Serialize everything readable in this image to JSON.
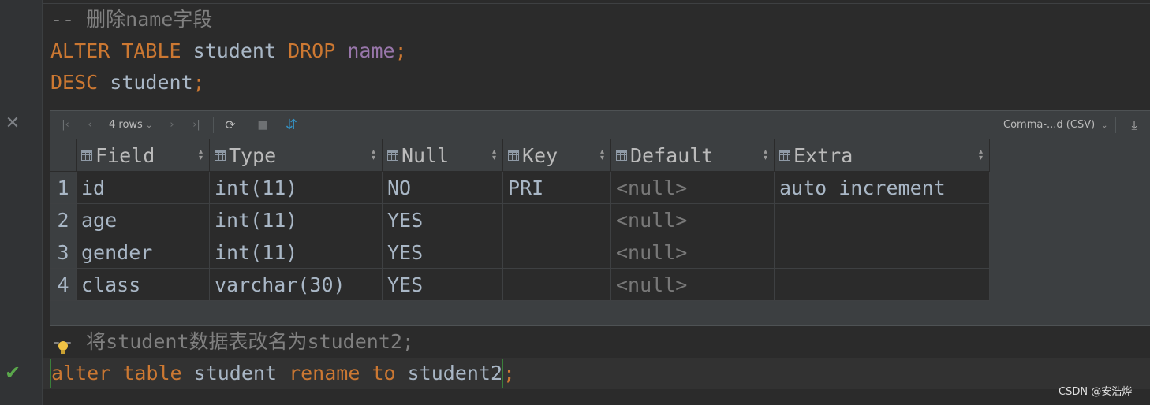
{
  "editor": {
    "line1": {
      "comment": "-- 删除name字段"
    },
    "line2": {
      "kw1": "ALTER",
      "kw2": "TABLE",
      "ident": "student",
      "kw3": "DROP",
      "col": "name",
      "semi": ";"
    },
    "line3": {
      "kw": "DESC",
      "ident": "student",
      "semi": ";"
    },
    "line5": {
      "comment": "-- 将student数据表改名为student2;"
    },
    "line6": {
      "kw1": "alter",
      "kw2": "table",
      "ident": "student",
      "kw3": "rename",
      "kw4": "to",
      "ident2": "student2",
      "semi": ";"
    }
  },
  "gutter": {
    "close_icon": "close-icon",
    "check_icon": "checkmark-icon"
  },
  "results": {
    "toolbar": {
      "rows_label": "4 rows",
      "export_format": "Comma-...d (CSV)",
      "icons": [
        "first-page-icon",
        "previous-page-icon",
        "next-page-icon",
        "last-page-icon",
        "refresh-icon",
        "stop-icon",
        "sort-icon",
        "download-icon"
      ]
    },
    "columns": [
      "Field",
      "Type",
      "Null",
      "Key",
      "Default",
      "Extra"
    ],
    "rows": [
      {
        "num": "1",
        "Field": "id",
        "Type": "int(11)",
        "Null": "NO",
        "Key": "PRI",
        "Default": "<null>",
        "Extra": "auto_increment"
      },
      {
        "num": "2",
        "Field": "age",
        "Type": "int(11)",
        "Null": "YES",
        "Key": "",
        "Default": "<null>",
        "Extra": ""
      },
      {
        "num": "3",
        "Field": "gender",
        "Type": "int(11)",
        "Null": "YES",
        "Key": "",
        "Default": "<null>",
        "Extra": ""
      },
      {
        "num": "4",
        "Field": "class",
        "Type": "varchar(30)",
        "Null": "YES",
        "Key": "",
        "Default": "<null>",
        "Extra": ""
      }
    ]
  },
  "watermark": "CSDN @安浩烨",
  "colors": {
    "keyword": "#cc7832",
    "identifier": "#a9b7c6",
    "column": "#9876aa",
    "comment": "#808080",
    "background": "#2b2b2b",
    "success": "#5aa74b"
  }
}
